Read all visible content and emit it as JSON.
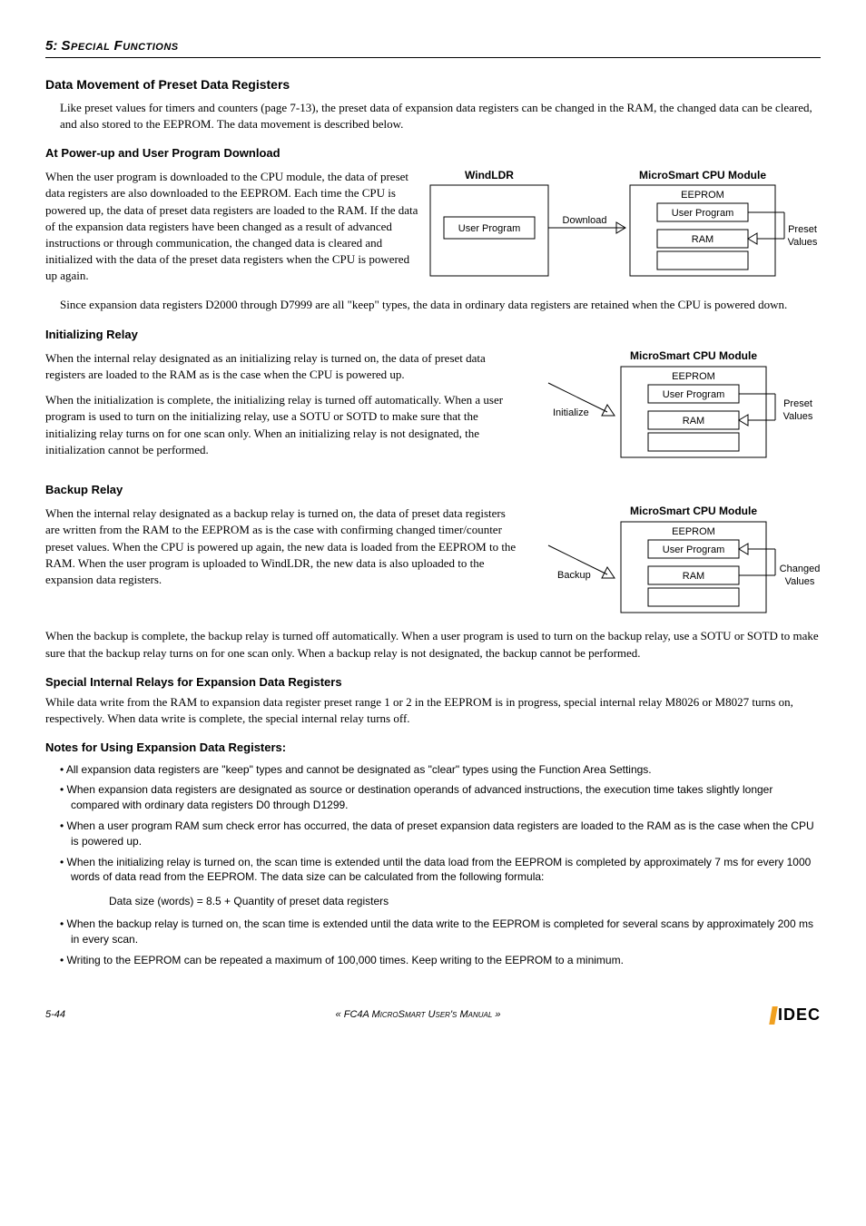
{
  "chapter": {
    "num": "5:",
    "word1": "Special",
    "word2": "Functions"
  },
  "section_title": "Data Movement of Preset Data Registers",
  "intro": "Like preset values for timers and counters (page 7-13), the preset data of expansion data registers can be changed in the RAM, the changed data can be cleared, and also stored to the EEPROM. The data movement is described below.",
  "powerup": {
    "title": "At Power-up and User Program Download",
    "p1": "When the user program is downloaded to the CPU module, the data of preset data registers are also downloaded to the EEPROM. Each time the CPU is powered up, the data of preset data registers are loaded to the RAM. If the data of the expansion data registers have been changed as a result of advanced instructions or through communication, the changed data is cleared and initialized with the data of the preset data registers when the CPU is powered up again.",
    "p2": "Since expansion data registers D2000 through D7999 are all \"keep\" types, the data in ordinary data registers are retained when the CPU is powered down."
  },
  "init": {
    "title": "Initializing Relay",
    "p1": "When the internal relay designated as an initializing relay is turned on, the data of preset data registers are loaded to the RAM as is the case when the CPU is powered up.",
    "p2": "When the initialization is complete, the initializing relay is turned off automatically. When a user program is used to turn on the initializing relay, use a SOTU or SOTD to make sure that the initializing relay turns on for one scan only. When an initializing relay is not designated, the initialization cannot be performed."
  },
  "backup": {
    "title": "Backup Relay",
    "p1": "When the internal relay designated as a backup relay is turned on, the data of preset data registers are written from the RAM to the EEPROM as is the case with confirming changed timer/counter preset values. When the CPU is powered up again, the new data is loaded from the EEPROM to the RAM. When the user program is uploaded to WindLDR, the new data is also uploaded to the expansion data registers.",
    "p2": "When the backup is complete, the backup relay is turned off automatically. When a user program is used to turn on the backup relay, use a SOTU or SOTD to make sure that the backup relay turns on for one scan only. When a backup relay is not designated, the backup cannot be performed."
  },
  "special": {
    "title": "Special Internal Relays for Expansion Data Registers",
    "p1": "While data write from the RAM to expansion data register preset range 1 or 2 in the EEPROM is in progress, special internal relay M8026 or M8027 turns on, respectively. When data write is complete, the special internal relay turns off."
  },
  "notes": {
    "title": "Notes for Using Expansion Data Registers:",
    "items": [
      "All expansion data registers are \"keep\" types and cannot be designated as \"clear\" types using the Function Area Settings.",
      "When expansion data registers are designated as source or destination operands of advanced instructions, the execution time takes slightly longer compared with ordinary data registers D0 through D1299.",
      "When a user program RAM sum check error has occurred, the data of preset expansion data registers are loaded to the RAM as is the case when the CPU is powered up.",
      "When the initializing relay is turned on, the scan time is extended until the data load from the EEPROM is completed by approximately 7 ms for every 1000 words of data read from the EEPROM. The data size can be calculated from the following formula:",
      "When the backup relay is turned on, the scan time is extended until the data write to the EEPROM is completed for several scans by approximately 200 ms in every scan.",
      "Writing to the EEPROM can be repeated a maximum of 100,000 times. Keep writing to the EEPROM to a minimum."
    ],
    "formula": "Data size (words) = 8.5 + Quantity of preset data registers"
  },
  "dia1": {
    "windldr": "WindLDR",
    "module": "MicroSmart CPU Module",
    "userprog": "User Program",
    "download": "Download",
    "eeprom": "EEPROM",
    "ram": "RAM",
    "preset": "Preset",
    "values": "Values"
  },
  "dia2": {
    "module": "MicroSmart CPU Module",
    "initialize": "Initialize",
    "eeprom": "EEPROM",
    "userprog": "User Program",
    "ram": "RAM",
    "preset": "Preset",
    "values": "Values"
  },
  "dia3": {
    "module": "MicroSmart CPU Module",
    "backup": "Backup",
    "eeprom": "EEPROM",
    "userprog": "User Program",
    "ram": "RAM",
    "changed": "Changed",
    "values": "Values"
  },
  "footer": {
    "page": "5-44",
    "manual": "« FC4A MicroSmart User's Manual »",
    "logo": "IDEC"
  }
}
